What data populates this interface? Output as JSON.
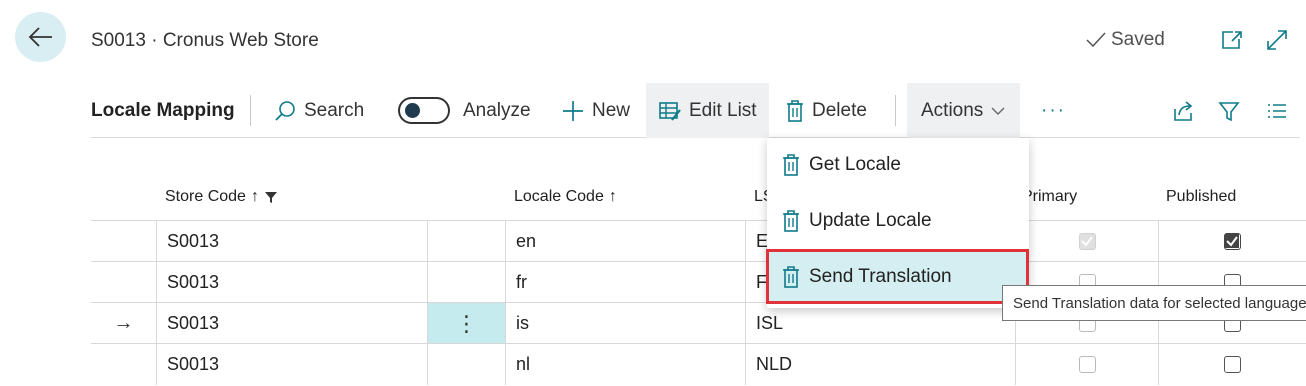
{
  "header": {
    "title": "S0013 · Cronus Web Store",
    "saved_label": "Saved"
  },
  "toolbar": {
    "page_name": "Locale Mapping",
    "search": "Search",
    "analyze": "Analyze",
    "new": "New",
    "edit_list": "Edit List",
    "delete": "Delete",
    "actions": "Actions",
    "more": "···"
  },
  "columns": {
    "store_code": "Store Code",
    "locale_code": "Locale Code",
    "ls": "LS",
    "primary": "Primary",
    "published": "Published",
    "sort_arrow": "↑"
  },
  "rows": [
    {
      "store_code": "S0013",
      "locale_code": "en",
      "ls": "EN",
      "primary": true,
      "published": true,
      "selected": false
    },
    {
      "store_code": "S0013",
      "locale_code": "fr",
      "ls": "FR",
      "primary": false,
      "published": false,
      "selected": false
    },
    {
      "store_code": "S0013",
      "locale_code": "is",
      "ls": "ISL",
      "primary": false,
      "published": false,
      "selected": true
    },
    {
      "store_code": "S0013",
      "locale_code": "nl",
      "ls": "NLD",
      "primary": false,
      "published": false,
      "selected": false
    }
  ],
  "row_marker": "→",
  "row_menu_glyph": "⋮",
  "actions_menu": {
    "items": [
      "Get Locale",
      "Update Locale",
      "Send Translation"
    ]
  },
  "tooltip": "Send Translation data for selected language",
  "colors": {
    "accent": "#0f7b8a",
    "highlight": "#d4eef1",
    "outline": "#e0323a",
    "back_bg": "#d9eef2"
  }
}
